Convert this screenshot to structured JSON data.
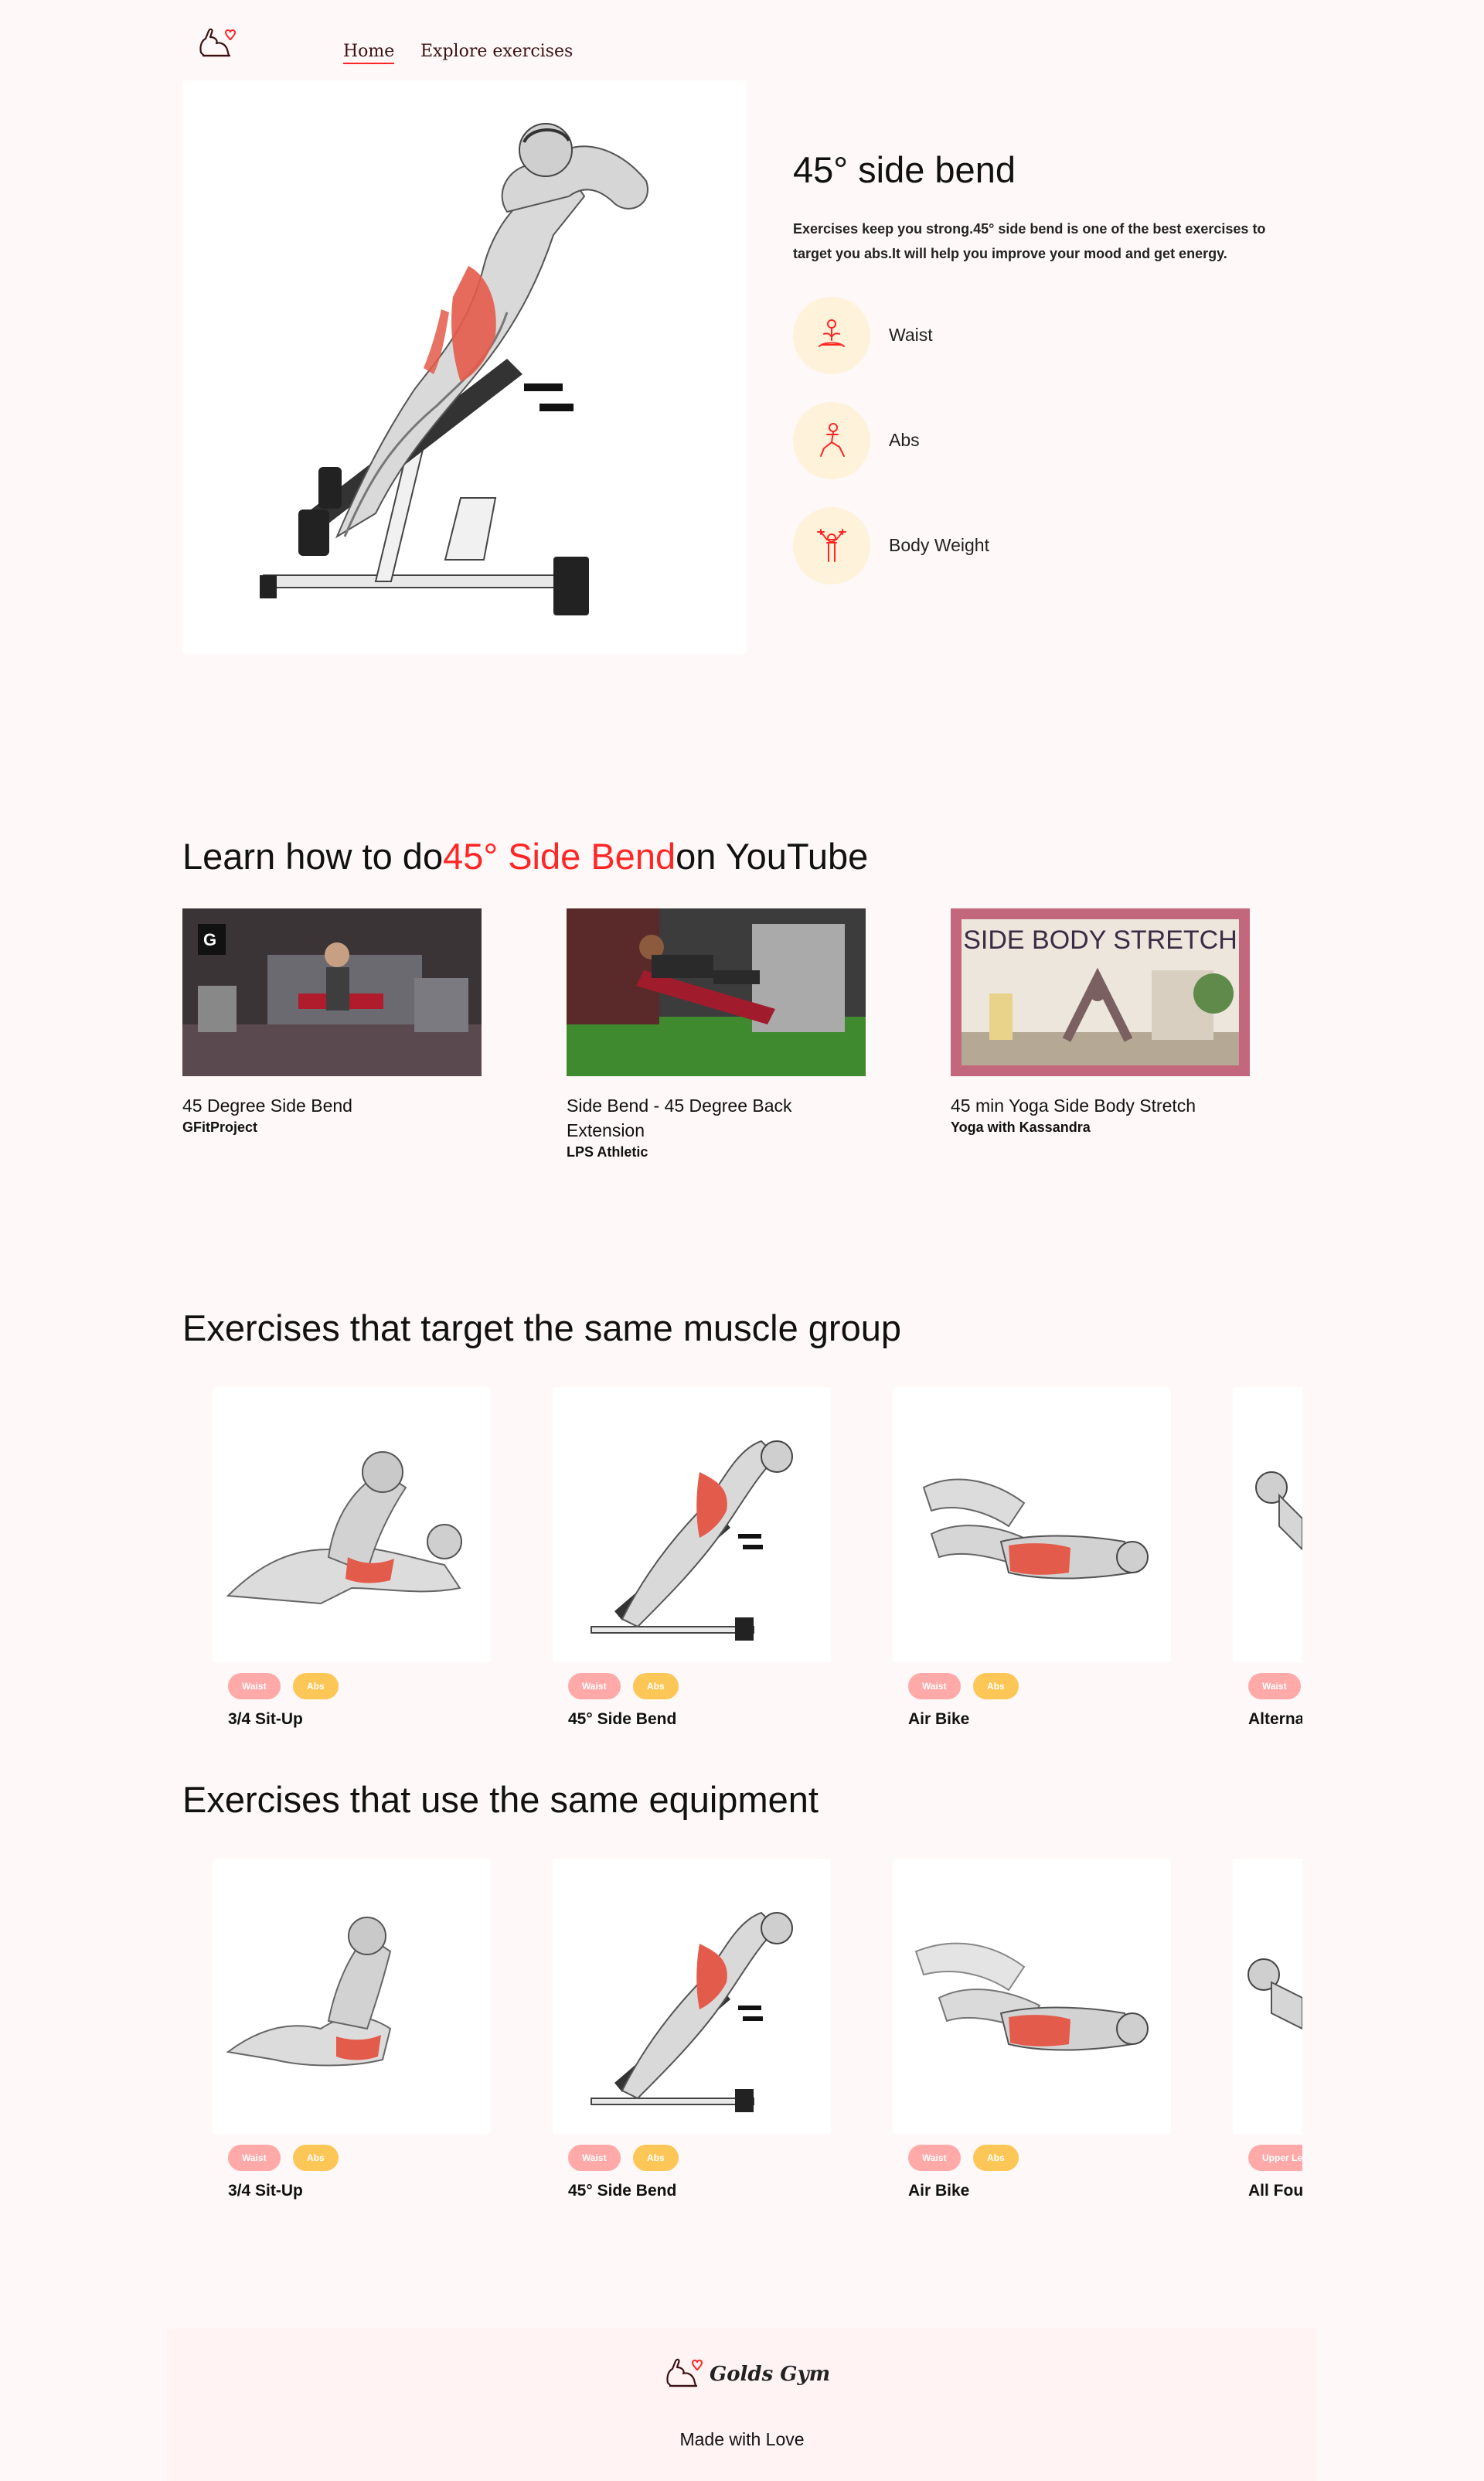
{
  "nav": {
    "home_label": "Home",
    "explore_label": "Explore exercises"
  },
  "exercise": {
    "title": "45° side bend",
    "description": "Exercises keep you strong.45° side bend is one of the best exercises to target you abs.It will help you improve your mood and get energy.",
    "details": [
      {
        "icon": "meditation-icon",
        "label": "Waist"
      },
      {
        "icon": "lunge-icon",
        "label": "Abs"
      },
      {
        "icon": "dumbbell-person-icon",
        "label": "Body Weight"
      }
    ]
  },
  "videos_section": {
    "prefix": "Learn how to do",
    "exercise_name": "45° Side Bend",
    "suffix": "on YouTube",
    "videos": [
      {
        "title": "45 Degree Side Bend",
        "channel": "GFitProject",
        "thumb_label": ""
      },
      {
        "title": "Side Bend - 45 Degree Back Extension",
        "channel": "LPS Athletic",
        "thumb_label": ""
      },
      {
        "title": "45 min Yoga Side Body Stretch",
        "channel": "Yoga with Kassandra",
        "thumb_label": "SIDE BODY STRETCH"
      }
    ]
  },
  "muscle_section": {
    "title": "Exercises that target the same muscle group",
    "cards": [
      {
        "tag1": "Waist",
        "tag2": "Abs",
        "name": "3/4 Sit-Up"
      },
      {
        "tag1": "Waist",
        "tag2": "Abs",
        "name": "45° Side Bend"
      },
      {
        "tag1": "Waist",
        "tag2": "Abs",
        "name": "Air Bike"
      },
      {
        "tag1": "Waist",
        "tag2": "",
        "name": "Alterna"
      }
    ]
  },
  "equipment_section": {
    "title": "Exercises that use the same equipment",
    "cards": [
      {
        "tag1": "Waist",
        "tag2": "Abs",
        "name": "3/4 Sit-Up"
      },
      {
        "tag1": "Waist",
        "tag2": "Abs",
        "name": "45° Side Bend"
      },
      {
        "tag1": "Waist",
        "tag2": "Abs",
        "name": "Air Bike"
      },
      {
        "tag1": "Upper Le",
        "tag2": "",
        "name": "All Fou"
      }
    ]
  },
  "footer": {
    "brand": "Golds Gym",
    "tagline": "Made with Love"
  },
  "colors": {
    "accent": "#ff2625",
    "background": "#fff8f8",
    "tag_pink": "#ffa9a9",
    "tag_yellow": "#fcc757",
    "icon_circle": "#fff2db"
  }
}
